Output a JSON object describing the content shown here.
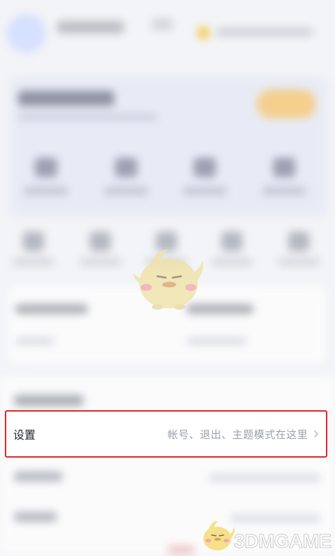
{
  "settings_row": {
    "label": "设置",
    "description": "帐号、退出、主题模式在这里"
  },
  "watermark": {
    "text": "3DMGAME"
  },
  "colors": {
    "highlight": "#e02626",
    "label_text": "#1f2330",
    "description_text": "#9aa0ad",
    "page_bg": "#f3f4f7"
  }
}
